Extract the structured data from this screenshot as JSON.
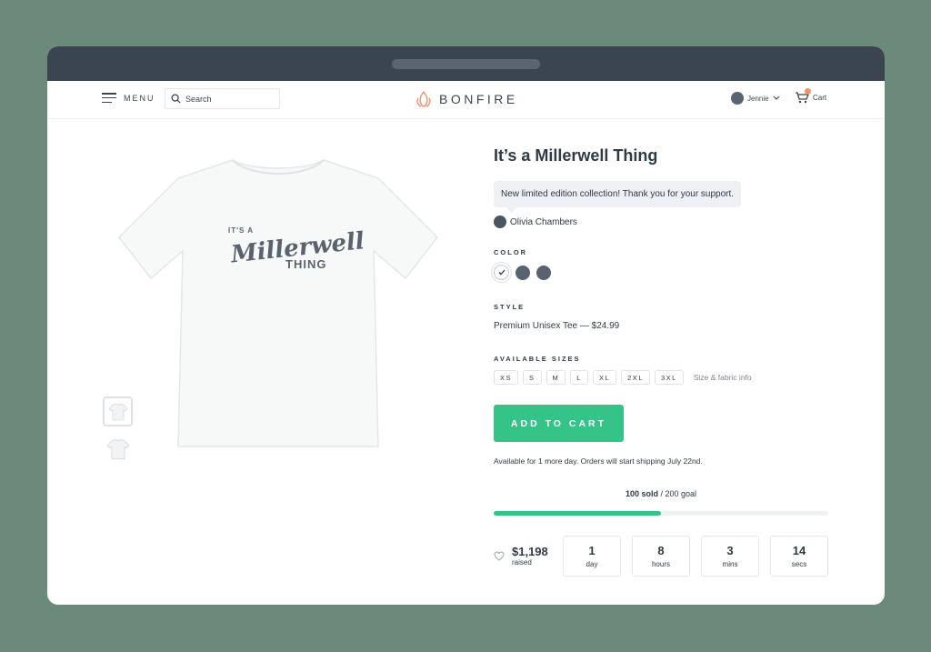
{
  "header": {
    "menu_label": "MENU",
    "search_placeholder": "Search",
    "brand": "BONFIRE",
    "user_name": "Jennie",
    "cart_label": "Cart"
  },
  "product": {
    "title": "It’s a Millerwell Thing",
    "shirt_print": {
      "line1": "IT'S A",
      "line2": "Millerwell",
      "line3": "THING"
    },
    "message": "New limited edition collection! Thank you for your support.",
    "creator": "Olivia Chambers",
    "color_label": "COLOR",
    "colors": [
      "#ffffff",
      "#59636d",
      "#59636d"
    ],
    "style_label": "STYLE",
    "style_value": "Premium Unisex Tee — $24.99",
    "sizes_label": "AVAILABLE SIZES",
    "sizes": [
      "XS",
      "S",
      "M",
      "L",
      "XL",
      "2XL",
      "3XL"
    ],
    "size_info": "Size & fabric info",
    "add_to_cart": "ADD TO CART",
    "availability": "Available for 1 more day. Orders will start shipping July 22nd."
  },
  "campaign": {
    "sold_count": "100 sold",
    "goal_text": " / 200 goal",
    "progress": 0.5,
    "raised_amount": "$1,198",
    "raised_label": "raised",
    "countdown": [
      {
        "value": "1",
        "unit": "day"
      },
      {
        "value": "8",
        "unit": "hours"
      },
      {
        "value": "3",
        "unit": "mins"
      },
      {
        "value": "14",
        "unit": "secs"
      }
    ]
  },
  "colors": {
    "background": "#6b8a7a",
    "titlebar": "#3b4552",
    "accent_green": "#34c487",
    "brand_flame": "#f0926a"
  }
}
